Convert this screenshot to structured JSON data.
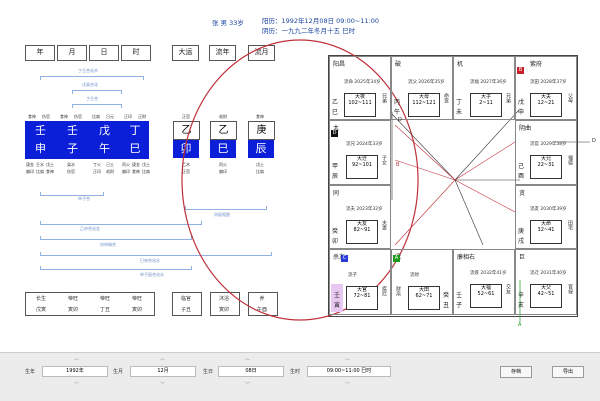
{
  "header": {
    "person": "张 男 33岁",
    "solar": "阳历：1992年12月08日 09:00~11:00",
    "lunar": "阴历：一九九二年冬月十五 巳时"
  },
  "pillar_headers": [
    "年",
    "月",
    "日",
    "时"
  ],
  "luck_headers": [
    "大运",
    "流年",
    "流月"
  ],
  "top_brackets": [
    "丁壬合化木",
    "戊癸合化",
    "丁壬合"
  ],
  "bottom_brackets": [
    "申子合",
    "乙申合化金",
    "卯申暗合",
    "巳申合化水",
    "申子辰合化水"
  ],
  "pillars": [
    {
      "ten_god_top": [
        "食神",
        "伤官"
      ],
      "stem": "壬",
      "branch": "申",
      "hidden": [
        "庚金",
        "壬水",
        "戊土"
      ],
      "ten_god_bottom": [
        "偏印",
        "比肩",
        "食神"
      ]
    },
    {
      "ten_god_top": [
        "食神",
        "伤官"
      ],
      "stem": "壬",
      "branch": "子",
      "hidden": [
        "癸水"
      ],
      "ten_god_bottom": [
        "伤官"
      ]
    },
    {
      "ten_god_top": [
        "比肩",
        "日元"
      ],
      "stem": "戊",
      "branch": "午",
      "hidden": [
        "丁火",
        "己土"
      ],
      "ten_god_bottom": [
        "正印",
        "劫财"
      ]
    },
    {
      "ten_god_top": [
        "正印",
        "正财"
      ],
      "stem": "丁",
      "branch": "巳",
      "hidden": [
        "丙火",
        "庚金",
        "戊土"
      ],
      "ten_god_bottom": [
        "偏印",
        "食神",
        "比肩"
      ]
    }
  ],
  "luck": [
    {
      "top": "正官",
      "stem": "乙",
      "branch": "卯",
      "hidden": "乙木",
      "god": "正官"
    },
    {
      "top": "劫财",
      "stem": "乙",
      "branch": "巳",
      "hidden": "丙火",
      "god": "偏印"
    },
    {
      "top": "食神",
      "stem": "庚",
      "branch": "辰",
      "hidden": "戊土",
      "god": "比肩"
    }
  ],
  "shensha_bracket": "卯辰相害",
  "stages": [
    {
      "top": "长生",
      "bottom": "戊寅"
    },
    {
      "top": "帝旺",
      "bottom": "寅卯"
    },
    {
      "top": "帝旺",
      "bottom": "丁丑"
    },
    {
      "top": "帝旺",
      "bottom": "寅卯"
    },
    {
      "top": "临官",
      "bottom": "子丑"
    },
    {
      "top": "沐浴",
      "bottom": "寅卯"
    },
    {
      "top": "养",
      "bottom": "午酉"
    }
  ],
  "palaces": [
    {
      "name": "阳昌",
      "yr": "流命\n2025年34岁",
      "box": "大夜\n102~111",
      "stem": "乙",
      "br": "巳",
      "god": "兄弟"
    },
    {
      "name": "破",
      "yr": "流父\n2026年35岁",
      "box": "大母\n112~121",
      "stem": "丙",
      "br": "午",
      "god": "命宫"
    },
    {
      "name": "机",
      "yr": "流福\n2027年36岁",
      "box": "大子\n2~11",
      "stem": "丁",
      "br": "未",
      "god": "兄弟"
    },
    {
      "name": "紫府",
      "yr": "流田\n2028年37岁",
      "box": "大夫\n12~21",
      "stem": "戊",
      "br": "申",
      "god": "父母"
    },
    {
      "name": "太",
      "yr": "流兄\n2024年33岁",
      "box": "大迁\n92~101",
      "stem": "甲",
      "br": "辰",
      "god": "子女"
    },
    {
      "name": "阴曲",
      "yr": "流官\n2029年38岁",
      "box": "大兄\n22~31",
      "stem": "己",
      "br": "酉",
      "god": "福德"
    },
    {
      "name": "同",
      "yr": "流夫\n2023年32岁",
      "box": "大友\n82~91",
      "stem": "癸",
      "br": "卯",
      "god": "夫妻"
    },
    {
      "name": "贪",
      "yr": "流友\n2030年39岁",
      "box": "大命\n32~41",
      "stem": "庚",
      "br": "戌",
      "god": "田宅"
    },
    {
      "name": "杀左",
      "yr": "流子",
      "box": "大官\n72~81",
      "stem": "壬",
      "br": "寅",
      "god": "疾厄"
    },
    {
      "name": "梁",
      "yr": "流财",
      "box": "大田\n62~71",
      "stem": "癸",
      "br": "丑",
      "god": "财帛"
    },
    {
      "name": "廉相右",
      "yr": "流疾\n2032年41岁",
      "box": "大福\n52~61",
      "stem": "壬",
      "br": "子",
      "god": "交友"
    },
    {
      "name": "巨",
      "yr": "流迁\n2031年40岁",
      "box": "大父\n42~51",
      "stem": "辛",
      "br": "亥",
      "god": "官禄"
    }
  ],
  "badges": [
    "B",
    "D",
    "C",
    "A"
  ],
  "marks": [
    "D",
    "B",
    "D",
    "A"
  ],
  "bottom_bar": {
    "year_label": "生年",
    "year_value": "1992年",
    "month_label": "生月",
    "month_value": "12月",
    "day_label": "生日",
    "day_value": "08日",
    "hour_label": "生时",
    "hour_value": "09:00~11:00 巳时",
    "save_label": "存档",
    "export_label": "导出"
  },
  "colors": {
    "accent": "#0b1fd8",
    "circle": "#c0303a",
    "bracket": "#8fb0e0"
  }
}
